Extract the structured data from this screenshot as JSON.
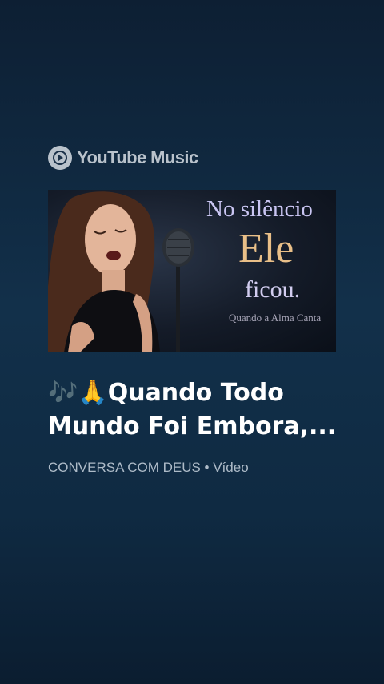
{
  "brand": {
    "name": "YouTube Music"
  },
  "thumbnail": {
    "line1": "No silêncio",
    "line2": "Ele",
    "line3": "ficou.",
    "line4": "Quando a Alma Canta"
  },
  "track": {
    "title": "🎶🙏Quando Todo\nMundo Foi Embora,...",
    "channel": "CONVERSA COM DEUS",
    "separator": " • ",
    "type": "Vídeo"
  },
  "colors": {
    "accent_gold": "#e9bf88",
    "accent_lavender": "#c9c5f2",
    "meta_text": "#aebbc8"
  }
}
